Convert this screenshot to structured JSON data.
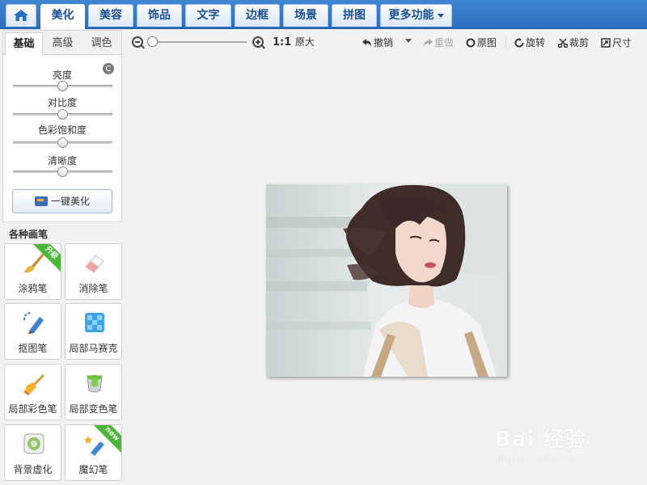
{
  "nav": {
    "tabs": [
      {
        "label": "美化",
        "active": true
      },
      {
        "label": "美容"
      },
      {
        "label": "饰品"
      },
      {
        "label": "文字"
      },
      {
        "label": "边框"
      },
      {
        "label": "场景"
      },
      {
        "label": "拼图"
      },
      {
        "label": "更多功能"
      }
    ]
  },
  "adjust": {
    "tabs": [
      {
        "label": "基础",
        "active": true
      },
      {
        "label": "高级"
      },
      {
        "label": "调色"
      }
    ],
    "sliders": [
      {
        "label": "亮度",
        "value": 0.5
      },
      {
        "label": "对比度",
        "value": 0.5
      },
      {
        "label": "色彩饱和度",
        "value": 0.5
      },
      {
        "label": "清晰度",
        "value": 0.5
      }
    ],
    "one_key_label": "一键美化"
  },
  "brushes": {
    "title": "各种画笔",
    "items": [
      {
        "label": "涂鸦笔",
        "icon": "paintbrush-icon",
        "badge": "升级"
      },
      {
        "label": "消除笔",
        "icon": "eraser-icon"
      },
      {
        "label": "抠图笔",
        "icon": "cutout-pen-icon"
      },
      {
        "label": "局部马赛克",
        "icon": "mosaic-icon"
      },
      {
        "label": "局部彩色笔",
        "icon": "color-brush-icon"
      },
      {
        "label": "局部变色笔",
        "icon": "paint-bucket-icon"
      },
      {
        "label": "背景虚化",
        "icon": "blur-background-icon"
      },
      {
        "label": "魔幻笔",
        "icon": "magic-pen-icon",
        "badge": "new"
      }
    ]
  },
  "toolbar": {
    "zoom_level": 0,
    "ratio_label": "1:1",
    "original_size_label": "原大",
    "undo_label": "撤销",
    "redo_label": "重做",
    "original_label": "原图",
    "rotate_label": "旋转",
    "crop_label": "裁剪",
    "size_label": "尺寸"
  },
  "watermark": {
    "main": "Bai 经验",
    "sub": "jingyan.baidu.com"
  },
  "colors": {
    "nav_bar": "#2f78c8",
    "badge_green": "#4bb63a"
  }
}
